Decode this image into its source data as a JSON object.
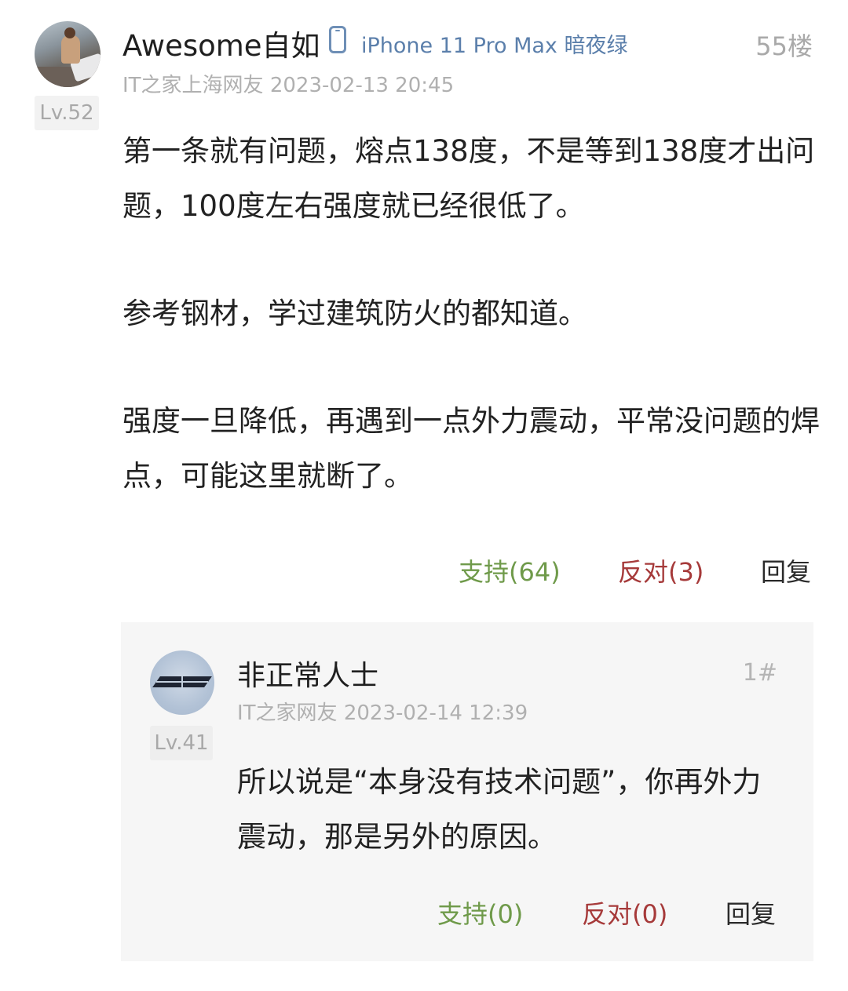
{
  "comment": {
    "username": "Awesome自如",
    "device_icon": "phone-icon",
    "device": "iPhone 11 Pro Max 暗夜绿",
    "floor": "55楼",
    "level": "Lv.52",
    "meta": "IT之家上海网友 2023-02-13 20:45",
    "paragraphs": [
      "第一条就有问题，熔点138度，不是等到138度才出问题，100度左右强度就已经很低了。",
      "参考钢材，学过建筑防火的都知道。",
      "强度一旦降低，再遇到一点外力震动，平常没问题的焊点，可能这里就断了。"
    ],
    "support_label": "支持(64)",
    "oppose_label": "反对(3)",
    "reply_label": "回复"
  },
  "reply": {
    "username": "非正常人士",
    "floor": "1#",
    "level": "Lv.41",
    "meta": "IT之家网友 2023-02-14 12:39",
    "content": "所以说是“本身没有技术问题”，你再外力震动，那是另外的原因。",
    "support_label": "支持(0)",
    "oppose_label": "反对(0)",
    "reply_label": "回复"
  },
  "colors": {
    "support": "#6f9a4a",
    "oppose": "#a63a3a",
    "device": "#5b7fab",
    "meta": "#b0b0b0",
    "reply_bg": "#f6f6f6"
  }
}
